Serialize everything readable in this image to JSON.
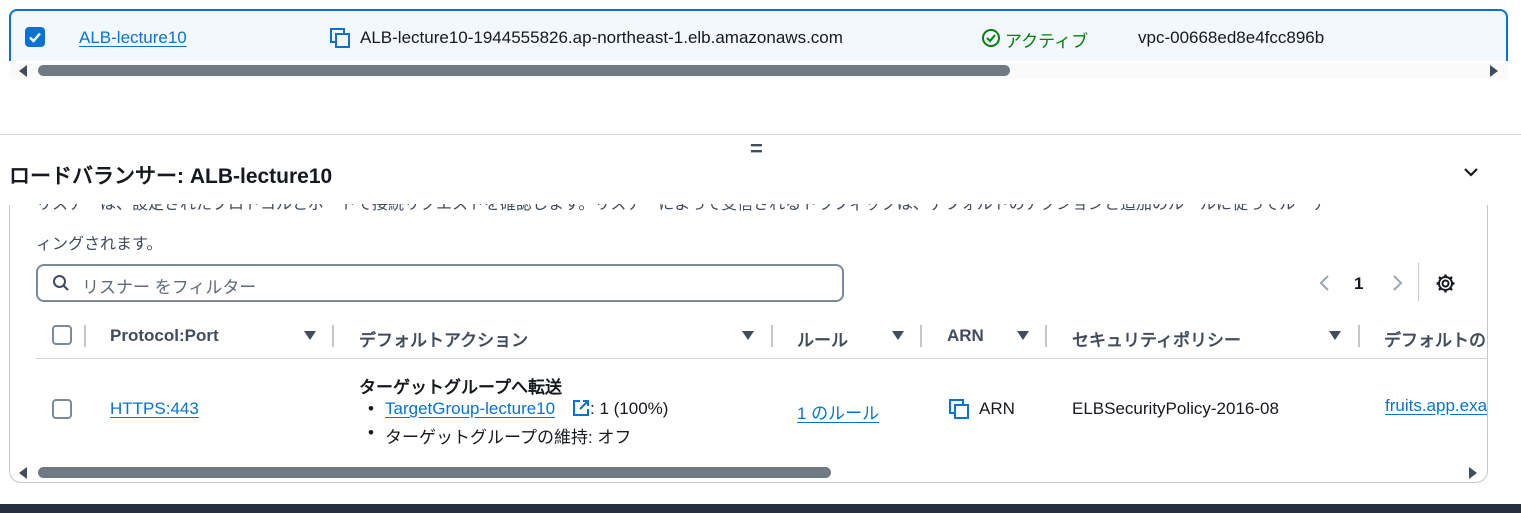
{
  "top_row": {
    "name": "ALB-lecture10",
    "dns": "ALB-lecture10-1944555826.ap-northeast-1.elb.amazonaws.com",
    "status": "アクティブ",
    "vpc": "vpc-00668ed8e4fcc896b",
    "scroll_position_fraction": 0.67
  },
  "handle_label": "=",
  "panel": {
    "title": "ロードバランサー: ALB-lecture10",
    "description_line1": "リスナーは、設定されたプロトコルとポートで接続リクエストを確認します。リスナーによって受信されるトラフィックは、デフォルトのアクションと追加のルールに従ってルーテ",
    "description_line2": "ィングされます。",
    "search_placeholder": "リスナー をフィルター",
    "pagination": {
      "current_page": "1"
    },
    "columns": [
      "Protocol:Port",
      "デフォルトアクション",
      "ルール",
      "ARN",
      "セキュリティポリシー",
      "デフォルトの"
    ],
    "rows": [
      {
        "protocol_port": "HTTPS:443",
        "action_title": "ターゲットグループへ転送",
        "target_group": "TargetGroup-lecture10",
        "target_weight": ": 1 (100%)",
        "stickiness": "ターゲットグループの維持: オフ",
        "rules": "1 のルール",
        "arn": "ARN",
        "security_policy": "ELBSecurityPolicy-2016-08",
        "default_cert": "fruits.app.exa"
      }
    ],
    "scroll_position_fraction": 0.55
  },
  "colors": {
    "accent": "#0972d3",
    "success": "#037f0c",
    "text": "#16191f"
  }
}
